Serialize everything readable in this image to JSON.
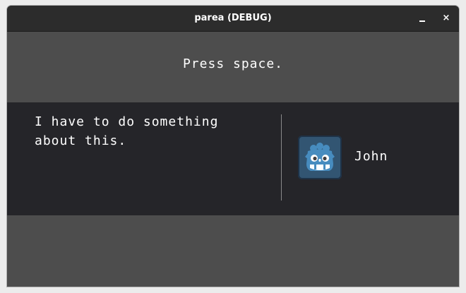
{
  "window": {
    "title": "parea (DEBUG)",
    "minimize_label": "_",
    "close_label": "×"
  },
  "prompt": {
    "text": "Press space."
  },
  "dialog": {
    "text": "I have to do something about this.",
    "speaker_name": "John",
    "avatar_icon": "godot-icon"
  },
  "colors": {
    "titlebar": "#2c2c2c",
    "background": "#4d4d4d",
    "dialog_background": "#252529",
    "avatar_blue": "#478cbf"
  }
}
